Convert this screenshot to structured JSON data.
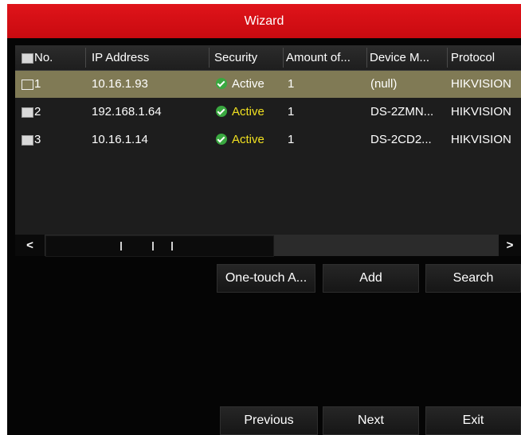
{
  "window": {
    "title": "Wizard"
  },
  "table": {
    "columns": [
      "No.",
      "IP Address",
      "Security",
      "Amount of...",
      "Device M...",
      "Protocol"
    ],
    "rows": [
      {
        "no": "1",
        "ip": "10.16.1.93",
        "security": "Active",
        "amount": "1",
        "model": "(null)",
        "protocol": "HIKVISION"
      },
      {
        "no": "2",
        "ip": "192.168.1.64",
        "security": "Active",
        "amount": "1",
        "model": "DS-2ZMN...",
        "protocol": "HIKVISION"
      },
      {
        "no": "3",
        "ip": "10.16.1.14",
        "security": "Active",
        "amount": "1",
        "model": "DS-2CD2...",
        "protocol": "HIKVISION"
      }
    ],
    "selected_row": "1",
    "status_colors": {
      "active_selected": "#ffffff",
      "active": "#f0e020",
      "check_icon": "#3aa840"
    }
  },
  "scrollbar": {
    "left_arrow": "<",
    "right_arrow": ">"
  },
  "actions": {
    "one_touch": "One-touch A...",
    "add": "Add",
    "search": "Search"
  },
  "footer": {
    "previous": "Previous",
    "next": "Next",
    "exit": "Exit"
  },
  "theme": {
    "title_bar": "#d0101a",
    "background": "#050505",
    "selected_row": "#807a55"
  }
}
